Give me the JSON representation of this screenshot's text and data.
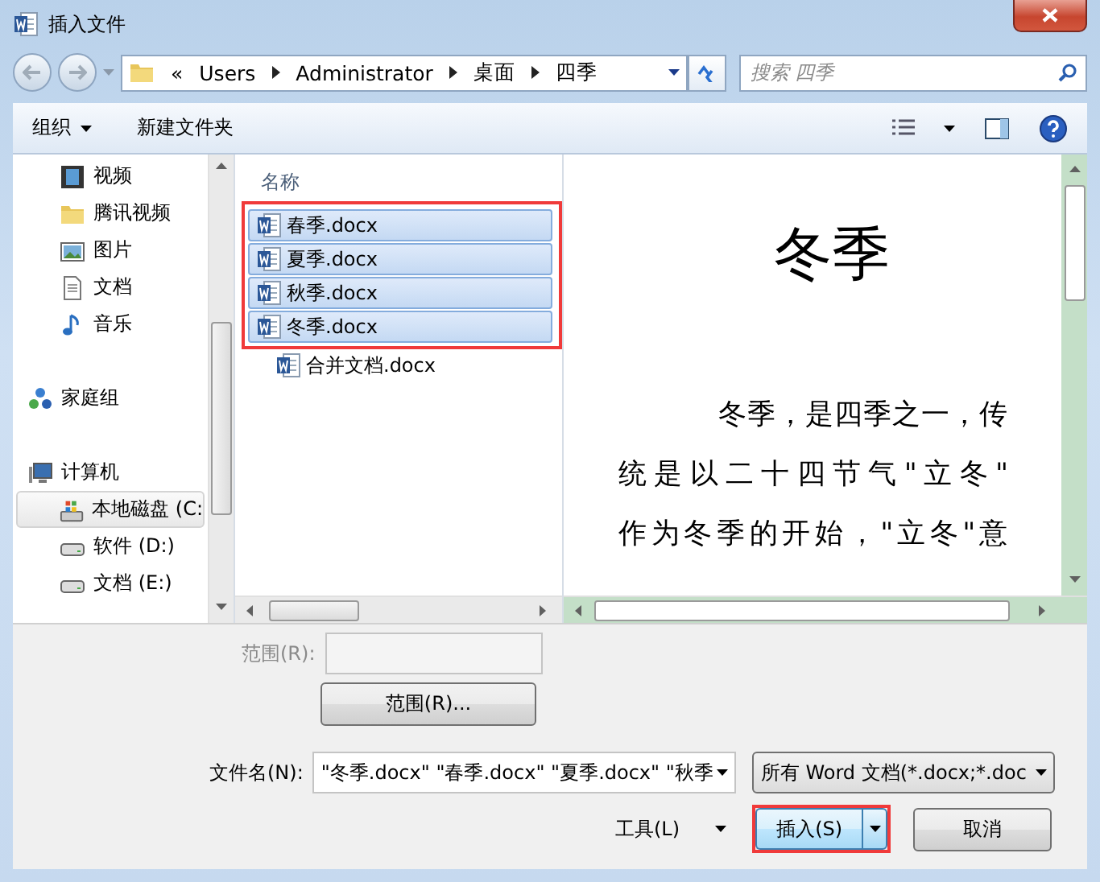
{
  "window": {
    "title": "插入文件"
  },
  "address_bar": {
    "overflow": "«",
    "crumbs": [
      "Users",
      "Administrator",
      "桌面",
      "四季"
    ]
  },
  "search": {
    "placeholder": "搜索 四季"
  },
  "toolbar": {
    "organize": "组织",
    "new_folder": "新建文件夹"
  },
  "sidebar": {
    "sections": [
      {
        "children": [
          {
            "label": "视频",
            "kind": "video",
            "selected": false
          },
          {
            "label": "腾讯视频",
            "kind": "folder",
            "selected": false
          },
          {
            "label": "图片",
            "kind": "picture",
            "selected": false
          },
          {
            "label": "文档",
            "kind": "document",
            "selected": false
          },
          {
            "label": "音乐",
            "kind": "music",
            "selected": false
          }
        ]
      },
      {
        "label": "家庭组",
        "kind": "homegroup"
      },
      {
        "label": "计算机",
        "kind": "computer",
        "children": [
          {
            "label": "本地磁盘 (C:",
            "kind": "system-drive",
            "selected": true
          },
          {
            "label": "软件 (D:)",
            "kind": "drive",
            "selected": false
          },
          {
            "label": "文档 (E:)",
            "kind": "drive",
            "selected": false
          }
        ]
      }
    ]
  },
  "file_list": {
    "column": "名称",
    "files": [
      {
        "name": "春季.docx",
        "selected": true,
        "highlighted": true
      },
      {
        "name": "夏季.docx",
        "selected": true,
        "highlighted": true
      },
      {
        "name": "秋季.docx",
        "selected": true,
        "highlighted": true
      },
      {
        "name": "冬季.docx",
        "selected": true,
        "highlighted": true
      },
      {
        "name": "合并文档.docx",
        "selected": false,
        "highlighted": false
      }
    ]
  },
  "preview": {
    "title": "冬季",
    "lines": [
      "冬季，是四季之一，传",
      "统是以二十四节气\"立冬\"",
      "作为冬季的开始，\"立冬\"意"
    ]
  },
  "range": {
    "label": "范围(R):",
    "disabled": true,
    "button": "范围(R)..."
  },
  "file_name": {
    "label": "文件名(N):",
    "value": "\"冬季.docx\" \"春季.docx\" \"夏季.docx\" \"秋季"
  },
  "file_type": {
    "value": "所有 Word 文档(*.docx;*.doc"
  },
  "tools": {
    "label": "工具(L)"
  },
  "insert_button": {
    "label": "插入(S)",
    "highlighted": true
  },
  "cancel_button": {
    "label": "取消"
  }
}
